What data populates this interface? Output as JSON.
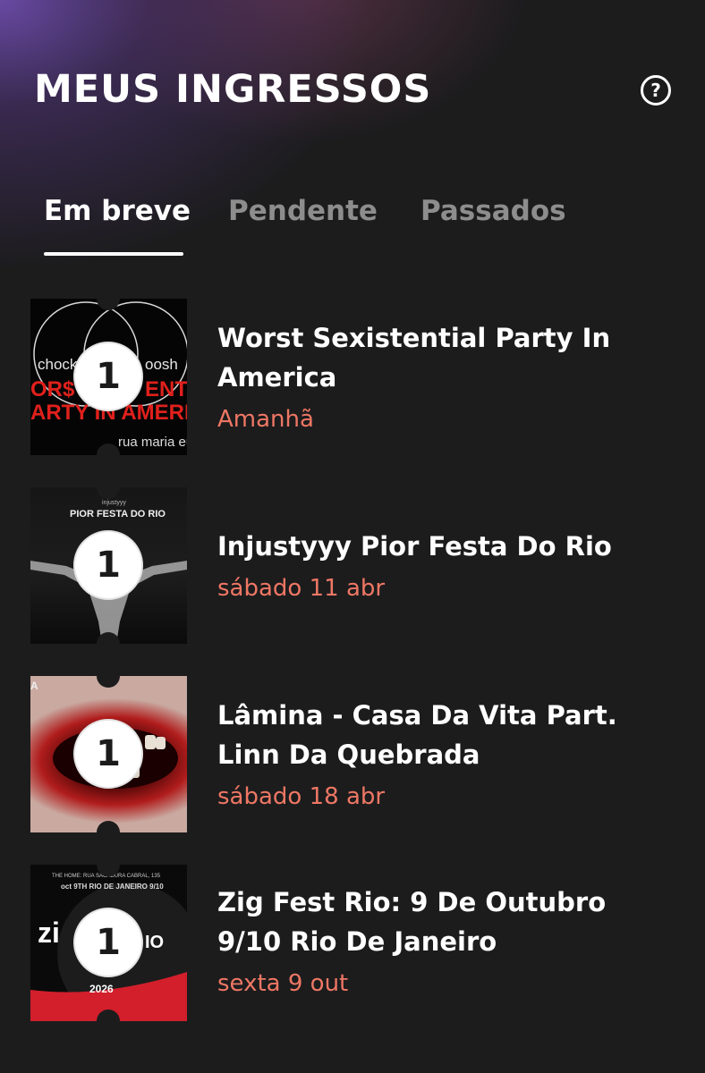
{
  "header": {
    "title": "MEUS INGRESSOS",
    "help_icon_glyph": "?"
  },
  "tabs": [
    {
      "label": "Em breve",
      "active": true
    },
    {
      "label": "Pendente",
      "active": false
    },
    {
      "label": "Passados",
      "active": false
    }
  ],
  "tickets": [
    {
      "quantity": "1",
      "title": "Worst Sexistential Party In America",
      "date": "Amanhã",
      "art": {
        "left_text": "chock",
        "right_text": "oosh",
        "big_line_1": "OR$T",
        "big_line_2": "ENT",
        "big_line_3": "ARTY IN AMERIC",
        "footer": "rua maria eu"
      }
    },
    {
      "quantity": "1",
      "title": "Injustyyy Pior Festa Do Rio",
      "date": "sábado 11 abr",
      "art": {
        "small": "injustyyy",
        "headline": "PIOR FESTA DO RIO"
      }
    },
    {
      "quantity": "1",
      "title": "Lâmina - Casa Da Vita Part. Linn Da Quebrada",
      "date": "sábado 18 abr",
      "art": {
        "corner": "A"
      }
    },
    {
      "quantity": "1",
      "title": "Zig Fest Rio: 9 De Outubro 9/10 Rio De Janeiro",
      "date": "sexta 9 out",
      "art": {
        "top_line": "THE HOME: RUA SACADURA CABRAL, 135",
        "sub_line": "oct 9TH RIO DE JANEIRO 9/10",
        "logo_left": "zi",
        "logo_right": "IO",
        "year": "2026"
      }
    }
  ],
  "colors": {
    "background": "#1c1c1d",
    "accent_date": "#ee7764",
    "tab_inactive": "#8d8d8e",
    "text_primary": "#ffffff"
  }
}
